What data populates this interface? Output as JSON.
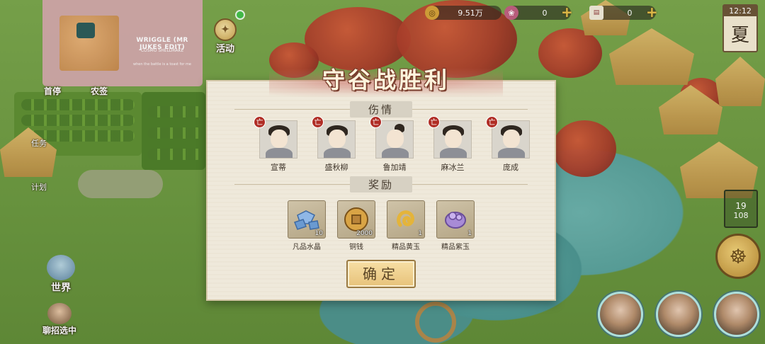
{
  "music_player": {
    "song_title": "WRIGGLE (MR JUKES EDIT)",
    "artist": "COSMO SHELDRAKE",
    "lyric": "when the battle is a toast for me"
  },
  "hud": {
    "activity_label": "活动",
    "currency": [
      {
        "icon": "copper-coin-icon",
        "value": "9.51万",
        "color": "#d6a23a"
      },
      {
        "icon": "jade-icon",
        "value": "0",
        "color": "#c06080"
      },
      {
        "icon": "ticket-icon",
        "value": "0",
        "color": "#8f3b3b"
      }
    ],
    "clock_time": "12:12",
    "season": "夏",
    "task_tab": "任务",
    "plan_tab": "计划",
    "world_label": "世界",
    "recruit_label": "聊招选中",
    "speed_top": "19",
    "speed_bottom": "108",
    "partial_labels": [
      "首停",
      "农签"
    ]
  },
  "dialog": {
    "title": "守谷战胜利",
    "injured_section": "伤情",
    "reward_section": "奖励",
    "members": [
      {
        "name": "宣蒂",
        "badge": "亡"
      },
      {
        "name": "盛秋柳",
        "badge": "亡"
      },
      {
        "name": "鲁加靖",
        "badge": "亡"
      },
      {
        "name": "麻冰兰",
        "badge": "亡"
      },
      {
        "name": "庞成",
        "badge": "亡"
      }
    ],
    "rewards": [
      {
        "label": "凡品水晶",
        "qty": "10",
        "icon": "crystal-icon",
        "color": "#6a9ad1"
      },
      {
        "label": "铜钱",
        "qty": "2000",
        "icon": "copper-coin-icon",
        "color": "#c9963b"
      },
      {
        "label": "精品黄玉",
        "qty": "1",
        "icon": "yellow-jade-icon",
        "color": "#e4b43a"
      },
      {
        "label": "精品紫玉",
        "qty": "1",
        "icon": "purple-jade-icon",
        "color": "#9a78c9"
      }
    ],
    "confirm_label": "确定"
  }
}
